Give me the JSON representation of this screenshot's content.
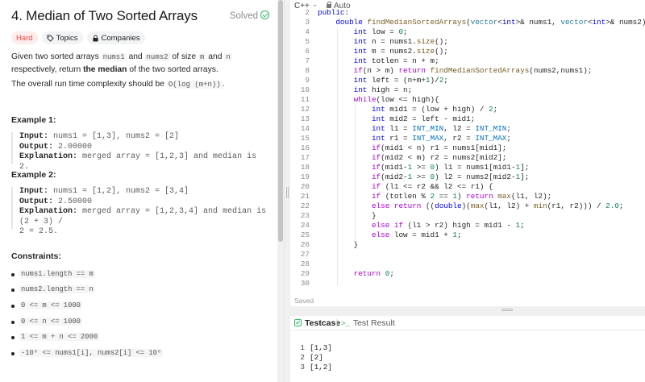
{
  "problem": {
    "title": "4. Median of Two Sorted Arrays",
    "status": "Solved",
    "tags": {
      "difficulty": "Hard",
      "topics": "Topics",
      "companies": "Companies"
    },
    "desc": {
      "t1": "Given two sorted arrays ",
      "c1": "nums1",
      "t2": " and ",
      "c2": "nums2",
      "t3": " of size ",
      "c3": "m",
      "t4": " and ",
      "c4": "n",
      "t5": " respectively, return ",
      "bold": "the median",
      "t6": " of the two sorted arrays."
    },
    "complexity": {
      "text": "The overall run time complexity should be ",
      "code": "O(log (m+n))",
      "end": "."
    },
    "examples": [
      {
        "title": "Example 1:",
        "input_label": "Input:",
        "input": "nums1 = [1,3], nums2 = [2]",
        "output_label": "Output:",
        "output": "2.00000",
        "expl_label": "Explanation:",
        "expl1": "merged array = [1,2,3] and median is 2.",
        "expl2": ""
      },
      {
        "title": "Example 2:",
        "input_label": "Input:",
        "input": "nums1 = [1,2], nums2 = [3,4]",
        "output_label": "Output:",
        "output": "2.50000",
        "expl_label": "Explanation:",
        "expl1": "merged array = [1,2,3,4] and median is (2 + 3) /",
        "expl2": "2 = 2.5."
      }
    ],
    "constraints_title": "Constraints:",
    "constraints": [
      "nums1.length == m",
      "nums2.length == n",
      "0 <= m <= 1000",
      "0 <= n <= 1000",
      "1 <= m + n <= 2000",
      "-10⁶ <= nums1[i], nums2[i] <= 10⁶"
    ]
  },
  "editor": {
    "language": "C++",
    "mode": "Auto",
    "saved": "Saved",
    "lines": [
      {
        "n": "2",
        "code": "public:"
      },
      {
        "n": "3",
        "code": "    double findMedianSortedArrays(vector<int>& nums1, vector<int>& nums2) {"
      },
      {
        "n": "4",
        "code": "        int low = 0;"
      },
      {
        "n": "5",
        "code": "        int n = nums1.size();"
      },
      {
        "n": "6",
        "code": "        int m = nums2.size();"
      },
      {
        "n": "7",
        "code": "        int totlen = n + m;"
      },
      {
        "n": "8",
        "code": "        if(n > m) return findMedianSortedArrays(nums2,nums1);"
      },
      {
        "n": "9",
        "code": "        int left = (n+m+1)/2;"
      },
      {
        "n": "10",
        "code": "        int high = n;"
      },
      {
        "n": "11",
        "code": "        while(low <= high){"
      },
      {
        "n": "12",
        "code": "            int mid1 = (low + high) / 2;"
      },
      {
        "n": "13",
        "code": "            int mid2 = left - mid1;"
      },
      {
        "n": "14",
        "code": "            int l1 = INT_MIN, l2 = INT_MIN;"
      },
      {
        "n": "15",
        "code": "            int r1 = INT_MAX, r2 = INT_MAX;"
      },
      {
        "n": "16",
        "code": "            if(mid1 < n) r1 = nums1[mid1];"
      },
      {
        "n": "17",
        "code": "            if(mid2 < m) r2 = nums2[mid2];"
      },
      {
        "n": "18",
        "code": "            if(mid1-1 >= 0) l1 = nums1[mid1-1];"
      },
      {
        "n": "19",
        "code": "            if(mid2-1 >= 0) l2 = nums2[mid2-1];"
      },
      {
        "n": "20",
        "code": "            if (l1 <= r2 && l2 <= r1) {"
      },
      {
        "n": "21",
        "code": "            if (totlen % 2 == 1) return max(l1, l2);"
      },
      {
        "n": "22",
        "code": "            else return ((double)(max(l1, l2) + min(r1, r2))) / 2.0;"
      },
      {
        "n": "23",
        "code": "            }"
      },
      {
        "n": "24",
        "code": "            else if (l1 > r2) high = mid1 - 1;"
      },
      {
        "n": "25",
        "code": "            else low = mid1 + 1;"
      },
      {
        "n": "26",
        "code": "        }"
      },
      {
        "n": "27",
        "code": ""
      },
      {
        "n": "28",
        "code": ""
      },
      {
        "n": "29",
        "code": "        return 0;"
      },
      {
        "n": "30",
        "code": ""
      }
    ]
  },
  "testcase": {
    "tab_testcase": "Testcase",
    "tab_result": "Test Result",
    "result_icon": ">_",
    "lines": [
      {
        "n": "1",
        "text": "[1,3]"
      },
      {
        "n": "2",
        "text": "[2]"
      },
      {
        "n": "3",
        "text": "[1,2]"
      }
    ]
  }
}
